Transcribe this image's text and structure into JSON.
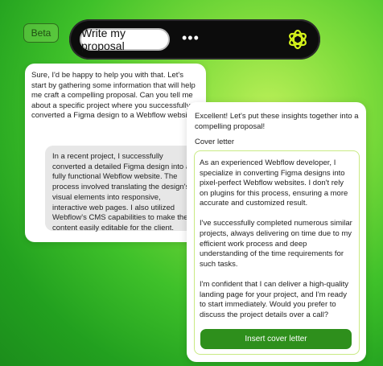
{
  "header": {
    "beta_label": "Beta",
    "prompt_label": "Write my proposal",
    "more_label": "•••"
  },
  "chat": {
    "assistant_message": "Sure, I'd be happy to help you with that. Let's start by gathering some information that will help me craft a compelling proposal. Can you tell me about a specific project where you successfully converted a Figma design to a Webflow website?",
    "user_message": "In a recent project, I successfully converted a detailed Figma design into a fully functional Webflow website. The process involved translating the design's visual elements into responsive, interactive web pages. I also utilized Webflow's CMS capabilities to make the content easily editable for the client."
  },
  "result": {
    "intro": "Excellent! Let's put these insights together into a compelling proposal!",
    "cover_letter_label": "Cover letter",
    "paragraphs": [
      "As an experienced Webflow developer, I specialize in converting Figma designs into pixel-perfect Webflow websites. I don't rely on plugins for this process, ensuring a more accurate and customized result.",
      "I've successfully completed numerous similar projects, always delivering on time due to my efficient work process and deep understanding of the time requirements for such tasks.",
      "I'm confident that I can deliver a high-quality landing page for your project, and I'm ready to start immediately. Would you prefer to discuss the project details over a call?"
    ],
    "insert_button_label": "Insert cover letter"
  },
  "colors": {
    "accent_green": "#2e8f1c",
    "letter_border": "#c9ea84",
    "logo_yellow": "#d4f21a"
  },
  "icons": {
    "logo": "openai-flower-icon"
  }
}
